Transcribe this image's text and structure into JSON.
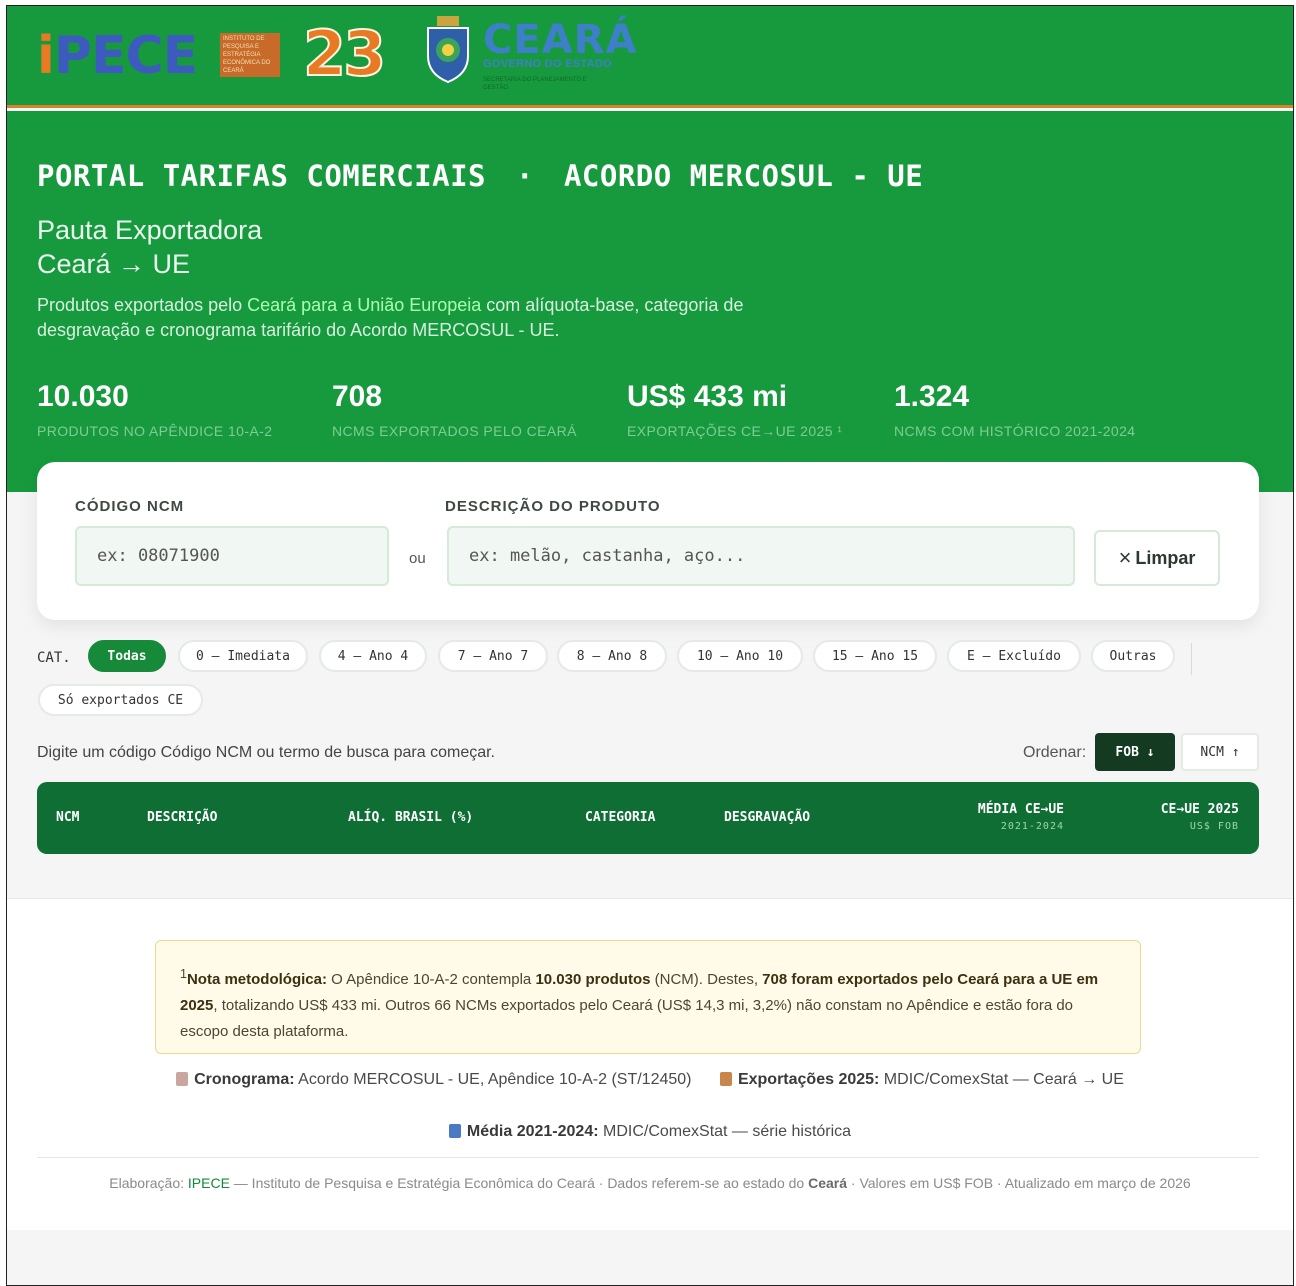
{
  "brand": {
    "ipece_text": "iPECE",
    "ipece_sub": "INSTITUTO DE PESQUISA E ESTRATÉGIA ECONÔMICA DO CEARÁ",
    "anniversary": "23",
    "ceara": "CEARÁ",
    "gov": "GOVERNO DO ESTADO",
    "secretaria": "SECRETARIA DO PLANEJAMENTO E GESTÃO"
  },
  "hero": {
    "title_left": "PORTAL TARIFAS COMERCIAIS",
    "title_sep": "·",
    "title_right": "ACORDO MERCOSUL - UE",
    "subtitle_1": "Pauta Exportadora",
    "subtitle_2": "Ceará → UE",
    "desc_1": "Produtos exportados pelo ",
    "desc_highlight": "Ceará para a União Europeia",
    "desc_2": " com alíquota-base, categoria de desgravação e cronograma tarifário do Acordo MERCOSUL - UE."
  },
  "stats": [
    {
      "value": "10.030",
      "label": "PRODUTOS NO APÊNDICE 10-A-2"
    },
    {
      "value": "708",
      "label": "NCMS EXPORTADOS PELO CEARÁ"
    },
    {
      "value": "US$ 433 mi",
      "label": "EXPORTAÇÕES CE→UE 2025 ¹"
    },
    {
      "value": "1.324",
      "label": "NCMS COM HISTÓRICO 2021-2024"
    }
  ],
  "search": {
    "ncm_label": "CÓDIGO NCM",
    "ncm_placeholder": "ex: 08071900",
    "or_label": "ou",
    "desc_label": "DESCRIÇÃO DO PRODUTO",
    "desc_placeholder": "ex: melão, castanha, aço...",
    "clear_label": "Limpar"
  },
  "filters": {
    "cat_label": "CAT.",
    "chips": [
      "Todas",
      "0 – Imediata",
      "4 – Ano 4",
      "7 – Ano 7",
      "8 – Ano 8",
      "10 – Ano 10",
      "15 – Ano 15",
      "E – Excluído",
      "Outras"
    ],
    "active": "Todas",
    "exported_only": "Só exportados CE"
  },
  "results": {
    "hint": "Digite um código Código NCM ou termo de busca para começar.",
    "order_label": "Ordenar:",
    "order_fob": "FOB ↓",
    "order_ncm": "NCM ↑"
  },
  "table": {
    "col_ncm": "NCM",
    "col_desc": "DESCRIÇÃO",
    "col_aliq": "ALÍQ. BRASIL (%)",
    "col_cat": "CATEGORIA",
    "col_desg": "DESGRAVAÇÃO",
    "col_media": "MÉDIA CE→UE",
    "col_media_sub": "2021-2024",
    "col_ceue": "CE→UE 2025",
    "col_ceue_sub": "US$ FOB"
  },
  "note": {
    "sup": "1",
    "title": "Nota metodológica:",
    "t1": " O Apêndice 10-A-2 contempla ",
    "b1": "10.030 produtos",
    "t2": " (NCM). Destes, ",
    "b2": "708 foram exportados pelo Ceará para a UE em 2025",
    "t3": ", totalizando US$ 433 mi. Outros 66 NCMs exportados pelo Ceará (US$ 14,3 mi, 3,2%) não constam no Apêndice e estão fora do escopo desta plataforma."
  },
  "sources": {
    "crono_title": "Cronograma:",
    "crono_text": " Acordo MERCOSUL - UE, Apêndice 10-A-2 (ST/12450)",
    "export_title": "Exportações 2025:",
    "export_text": " MDIC/ComexStat — Ceará → UE",
    "media_title": "Média 2021-2024:",
    "media_text": " MDIC/ComexStat — série histórica"
  },
  "credits": {
    "prefix": "Elaboração: ",
    "ipece": "IPECE",
    "t1": " — Instituto de Pesquisa e Estratégia Econômica do Ceará · Dados referem-se ao estado do ",
    "ceara": "Ceará",
    "t2": " · Valores em US$ FOB · Atualizado em março de 2026"
  },
  "colors": {
    "primary_green": "#179a3e",
    "dark_green": "#0e6e33",
    "accent_orange": "#e87a23",
    "highlight": "#a8ffb4"
  }
}
